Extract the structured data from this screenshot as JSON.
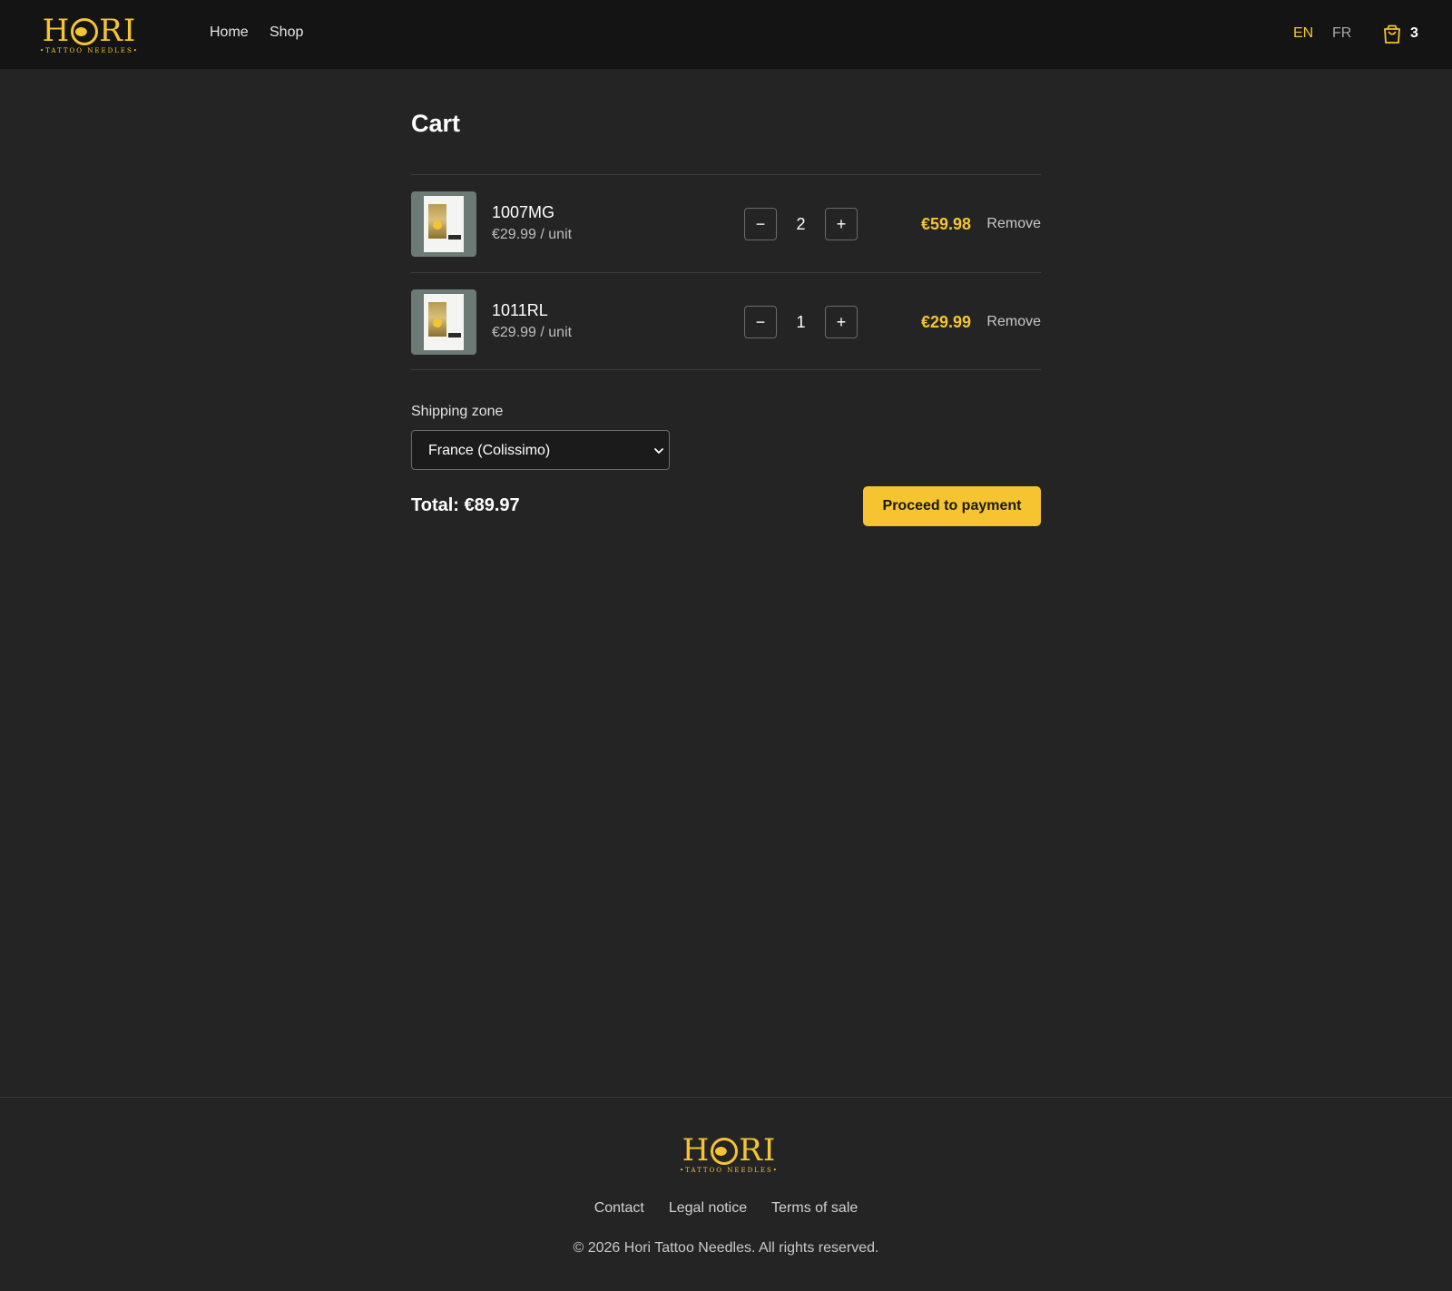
{
  "brand": {
    "name": "HORI",
    "tagline": "•TATTOO NEEDLES•",
    "accent": "#f5c430"
  },
  "nav": {
    "home": "Home",
    "shop": "Shop"
  },
  "lang": {
    "en": "EN",
    "fr": "FR",
    "active": "EN"
  },
  "cart_badge": {
    "icon": "shopping-bag-icon",
    "count": "3"
  },
  "page": {
    "title": "Cart"
  },
  "items": [
    {
      "name": "1007MG",
      "unit_price": "€29.99 / unit",
      "qty": "2",
      "line_total": "€59.98",
      "remove": "Remove",
      "minus": "−",
      "plus": "+"
    },
    {
      "name": "1011RL",
      "unit_price": "€29.99 / unit",
      "qty": "1",
      "line_total": "€29.99",
      "remove": "Remove",
      "minus": "−",
      "plus": "+"
    }
  ],
  "shipping": {
    "label": "Shipping zone",
    "selected": "France (Colissimo)"
  },
  "summary": {
    "total": "Total: €89.97",
    "pay_button": "Proceed to payment"
  },
  "footer": {
    "links": [
      "Contact",
      "Legal notice",
      "Terms of sale"
    ],
    "copyright": "© 2026 Hori Tattoo Needles. All rights reserved."
  }
}
